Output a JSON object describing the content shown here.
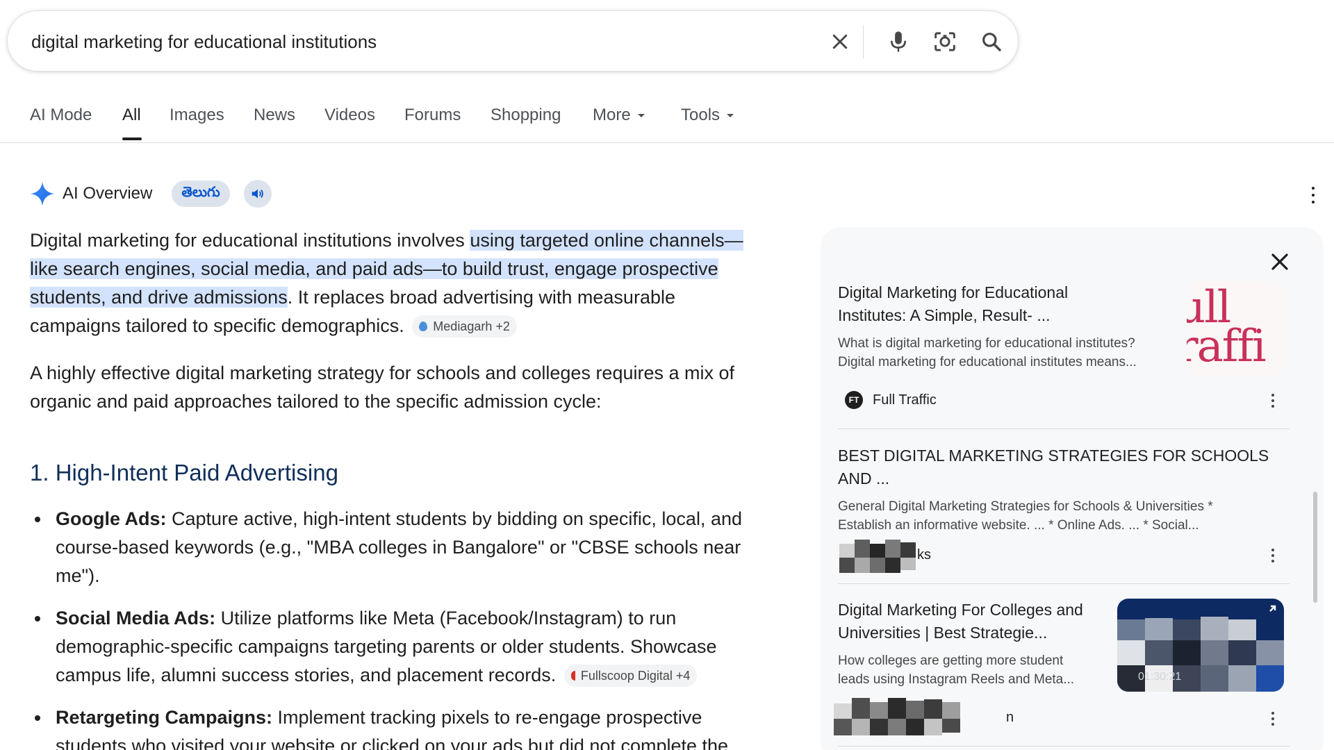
{
  "search": {
    "query": "digital marketing for educational institutions"
  },
  "tabs": [
    {
      "label": "AI Mode"
    },
    {
      "label": "All"
    },
    {
      "label": "Images"
    },
    {
      "label": "News"
    },
    {
      "label": "Videos"
    },
    {
      "label": "Forums"
    },
    {
      "label": "Shopping"
    },
    {
      "label": "More"
    },
    {
      "label": "Tools"
    }
  ],
  "ai_overview": {
    "title": "AI Overview",
    "language_chip": "తెలుగు",
    "p1": {
      "lead": "Digital marketing for educational institutions involves ",
      "highlight": "using targeted online channels—like search engines, social media, and paid ads—to build trust, engage prospective students, and drive admissions",
      "tail": ". It replaces broad advertising with measurable campaigns tailored to specific demographics.",
      "citation": "Mediagarh +2"
    },
    "p2": "A highly effective digital marketing strategy for schools and colleges requires a mix of organic and paid approaches tailored to the specific admission cycle:",
    "section_title": "1. High-Intent Paid Advertising",
    "bullets": [
      {
        "label": "Google Ads:",
        "text": " Capture active, high-intent students by bidding on specific, local, and course-based keywords (e.g., \"MBA colleges in Bangalore\" or \"CBSE schools near me\")."
      },
      {
        "label": "Social Media Ads:",
        "text": " Utilize platforms like Meta (Facebook/Instagram) to run demographic-specific campaigns targeting parents or older students. Showcase campus life, alumni success stories, and placement records.",
        "citation": "Fullscoop Digital +4"
      },
      {
        "label": "Retargeting Campaigns:",
        "text": " Implement tracking pixels to re-engage prospective students who visited your website or clicked on your ads but did not complete the"
      }
    ]
  },
  "sources": [
    {
      "title": "Digital Marketing for Educational Institutes: A Simple, Result- ...",
      "snippet": "What is digital marketing for educational institutes? Digital marketing for educational institutes means...",
      "source_name": "Full Traffic",
      "thumb_text": "ull raffi"
    },
    {
      "title": "BEST DIGITAL MARKETING STRATEGIES FOR SCHOOLS AND ...",
      "snippet": "General Digital Marketing Strategies for Schools & Universities * Establish an informative website. ... * Online Ads. ... * Social...",
      "source_name": "ks"
    },
    {
      "title": "Digital Marketing For Colleges and Universities | Best Strategie...",
      "snippet": "How colleges are getting more student leads using Instagram Reels and Meta...",
      "source_name": "n",
      "duration": "01:30:21"
    }
  ]
}
